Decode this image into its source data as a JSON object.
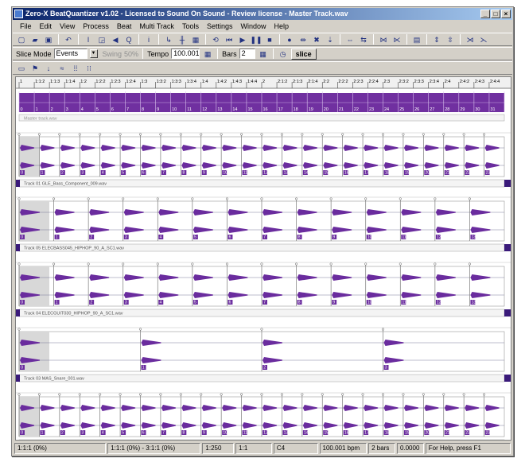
{
  "window": {
    "title": "Zero-X BeatQuantizer v1.02 - Licensed to Sound On Sound - Review license - Master Track.wav",
    "min_label": "_",
    "max_label": "□",
    "close_label": "×"
  },
  "menu": [
    "File",
    "Edit",
    "View",
    "Process",
    "Beat",
    "Multi Track",
    "Tools",
    "Settings",
    "Window",
    "Help"
  ],
  "toolbar1": [
    {
      "name": "new-file-icon",
      "glyph": "▢"
    },
    {
      "name": "open-folder-icon",
      "glyph": "▰"
    },
    {
      "name": "save-disk-icon",
      "glyph": "▣"
    },
    {
      "sep": true
    },
    {
      "name": "undo-icon",
      "glyph": "↶"
    },
    {
      "sep": true
    },
    {
      "name": "text-cursor-icon",
      "glyph": "I"
    },
    {
      "name": "select-region-icon",
      "glyph": "◲"
    },
    {
      "name": "speaker-icon",
      "glyph": "◀"
    },
    {
      "name": "zoom-icon",
      "glyph": "Q"
    },
    {
      "sep": true
    },
    {
      "name": "info-icon",
      "glyph": "i"
    },
    {
      "sep": true
    },
    {
      "name": "marker-icon",
      "glyph": "↳"
    },
    {
      "name": "beat-markers-icon",
      "glyph": "╫"
    },
    {
      "name": "grid-icon",
      "glyph": "▦"
    },
    {
      "sep": true
    },
    {
      "name": "loop-icon",
      "glyph": "⟲"
    },
    {
      "name": "rewind-icon",
      "glyph": "⏮"
    },
    {
      "name": "play-icon",
      "glyph": "▶"
    },
    {
      "name": "pause-icon",
      "glyph": "❚❚"
    },
    {
      "name": "stop-icon",
      "glyph": "■"
    },
    {
      "sep": true
    },
    {
      "name": "record-icon",
      "glyph": "●"
    },
    {
      "name": "cut-marker-icon",
      "glyph": "⇹"
    },
    {
      "name": "delete-marker-icon",
      "glyph": "✖"
    },
    {
      "name": "insert-marker-icon",
      "glyph": "⇣"
    },
    {
      "sep": true
    },
    {
      "name": "expand-horizontal-icon",
      "glyph": "⇔"
    },
    {
      "name": "shrink-horizontal-icon",
      "glyph": "⇆"
    },
    {
      "sep": true
    },
    {
      "name": "zoom-in-h-icon",
      "glyph": "⋈"
    },
    {
      "name": "zoom-out-h-icon",
      "glyph": "⋉"
    },
    {
      "sep": true
    },
    {
      "name": "fit-icon",
      "glyph": "▤"
    },
    {
      "sep": true
    },
    {
      "name": "expand-vertical-icon",
      "glyph": "⇕"
    },
    {
      "name": "shrink-vertical-icon",
      "glyph": "⇳"
    },
    {
      "sep": true
    },
    {
      "name": "zoom-in-v-icon",
      "glyph": "⋊"
    },
    {
      "name": "zoom-out-v-icon",
      "glyph": "⋋"
    }
  ],
  "toolbar2": {
    "slice_mode_label": "Slice Mode",
    "slice_mode_value": "Events",
    "swing_label": "Swing",
    "swing_value": "50%",
    "tempo_label": "Tempo",
    "tempo_value": "100.001",
    "bars_label": "Bars",
    "bars_value": "2",
    "slice_button": "slice"
  },
  "toolbar3": [
    {
      "name": "view-window-icon",
      "glyph": "▭"
    },
    {
      "name": "green-flag-icon",
      "glyph": "⚑"
    },
    {
      "name": "arrow-down-icon",
      "glyph": "↓"
    },
    {
      "name": "wave-icon",
      "glyph": "≈"
    },
    {
      "name": "grid-dots-icon",
      "glyph": "⁞⁞"
    },
    {
      "name": "grid-dots2-icon",
      "glyph": "⁝⁝"
    }
  ],
  "ruler_labels": [
    "1",
    "1:1:2",
    "1:1:3",
    "1:1:4",
    "1:2",
    "1:2:2",
    "1:2:3",
    "1:2:4",
    "1:3",
    "1:3:2",
    "1:3:3",
    "1:3:4",
    "1:4",
    "1:4:2",
    "1:4:3",
    "1:4:4",
    "2",
    "2:1:2",
    "2:1:3",
    "2:1:4",
    "2:2",
    "2:2:2",
    "2:2:3",
    "2:2:4",
    "2:3",
    "2:3:2",
    "2:3:3",
    "2:3:4",
    "2:4",
    "2:4:2",
    "2:4:3",
    "2:4:4"
  ],
  "master_track": {
    "label": "Master track.wav",
    "markers": [
      "0",
      "1",
      "2",
      "3",
      "4",
      "5",
      "6",
      "7",
      "8",
      "9",
      "10",
      "11",
      "12",
      "13",
      "14",
      "15",
      "16",
      "17",
      "18",
      "19",
      "20",
      "21",
      "22",
      "23",
      "24",
      "25",
      "26",
      "27",
      "28",
      "29",
      "30",
      "31",
      "32"
    ]
  },
  "tracks": [
    {
      "label": "Track 01 GLE_Bass_Component_009.wav"
    },
    {
      "label": "Track 05 ELECBASS045_HIPHOP_90_A_SC1.wav"
    },
    {
      "label": "Track 04 ELECGUIT030_HIPHOP_90_A_SC1.wav"
    },
    {
      "label": "Track 03 MAS_Snare_001.wav"
    },
    {
      "label": "Track 02 MAS_Kick_001.wav"
    }
  ],
  "status": [
    "1:1:1 (0%)",
    "1:1:1 (0%) - 3:1:1 (0%)",
    "1:250",
    "1:1",
    "C4",
    "100.001 bpm",
    "2 bars",
    "0.0000",
    "For Help, press F1"
  ],
  "colors": {
    "waveform": "#6a2c9e",
    "master_band": "#7030a0",
    "accent": "#0a246a",
    "marker": "#7a7a7a"
  }
}
